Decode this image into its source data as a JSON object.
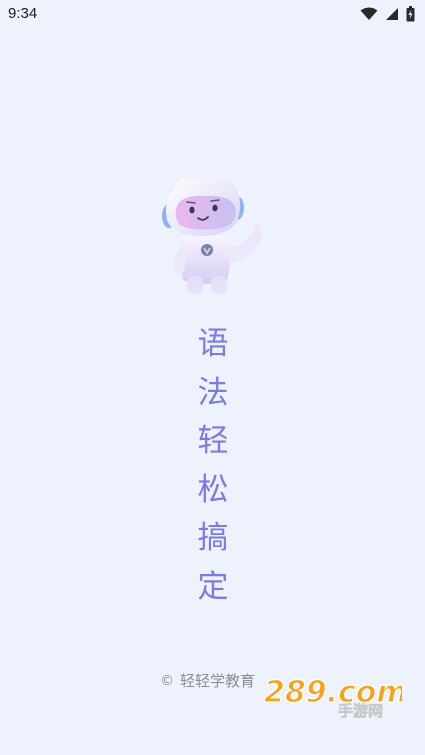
{
  "status_bar": {
    "time": "9:34",
    "icons": [
      "wifi-icon",
      "signal-icon",
      "battery-icon"
    ]
  },
  "mascot": {
    "icon": "robot-mascot-icon"
  },
  "slogan": {
    "chars": [
      "语",
      "法",
      "轻",
      "松",
      "搞",
      "定"
    ]
  },
  "footer": {
    "copyright_symbol": "©",
    "company": "轻轻学教育"
  },
  "watermark": {
    "logo_text": "289.com",
    "sub_text": "手游网"
  },
  "colors": {
    "background": "#eef2fd",
    "slogan": "#7d7be0",
    "footer_text": "#8c8c99"
  }
}
